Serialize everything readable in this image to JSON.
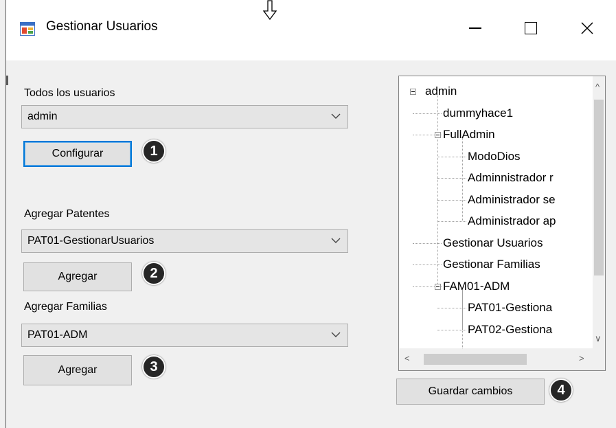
{
  "window": {
    "title": "Gestionar Usuarios"
  },
  "users": {
    "label": "Todos los usuarios",
    "selected": "admin",
    "configure_button": "Configurar",
    "badge": "1"
  },
  "patents": {
    "label": "Agregar Patentes",
    "selected": "PAT01-GestionarUsuarios",
    "add_button": "Agregar",
    "badge": "2"
  },
  "families": {
    "label": "Agregar Familias",
    "selected": "PAT01-ADM",
    "add_button": "Agregar",
    "badge": "3"
  },
  "tree": {
    "nodes": [
      {
        "label": "admin",
        "level": 0,
        "expander": true
      },
      {
        "label": "dummyhace1",
        "level": 1,
        "expander": false
      },
      {
        "label": "FullAdmin",
        "level": 1,
        "expander": true
      },
      {
        "label": "ModoDios",
        "level": 2,
        "expander": false
      },
      {
        "label": "Adminnistrador r",
        "level": 2,
        "expander": false
      },
      {
        "label": "Administrador se",
        "level": 2,
        "expander": false
      },
      {
        "label": "Administrador ap",
        "level": 2,
        "expander": false
      },
      {
        "label": "Gestionar Usuarios",
        "level": 1,
        "expander": false
      },
      {
        "label": "Gestionar Familias",
        "level": 1,
        "expander": false
      },
      {
        "label": "FAM01-ADM",
        "level": 1,
        "expander": true
      },
      {
        "label": "PAT01-Gestiona",
        "level": 2,
        "expander": false
      },
      {
        "label": "PAT02-Gestiona",
        "level": 2,
        "expander": false
      }
    ]
  },
  "save": {
    "button": "Guardar cambios",
    "badge": "4"
  },
  "icons": {
    "app": "app-window-icon",
    "cursor": "down-arrow-cursor-icon",
    "minimize": "minimize-icon",
    "maximize": "maximize-icon",
    "close": "close-icon",
    "dropdown": "chevron-down-icon"
  }
}
